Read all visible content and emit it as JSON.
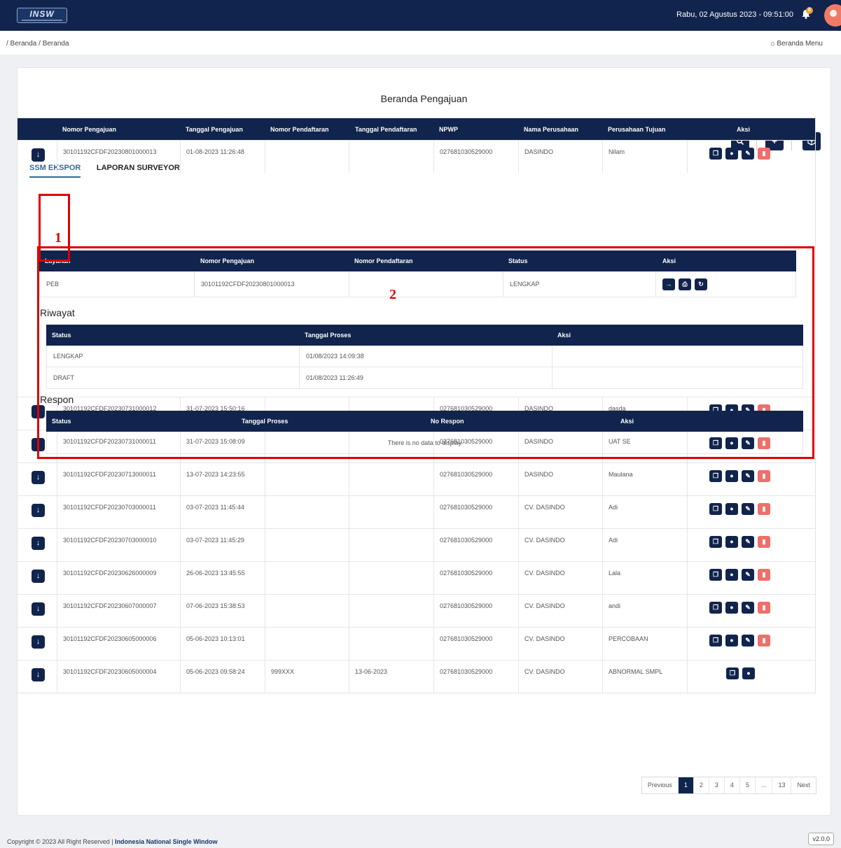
{
  "header": {
    "logo_text": "INSW",
    "datetime": "Rabu, 02 Agustus 2023 - 09:51:00",
    "notif_count": "0"
  },
  "breadcrumb": {
    "path": "/ Beranda / Beranda",
    "home_menu": "Beranda Menu"
  },
  "page": {
    "title": "Beranda Pengajuan"
  },
  "tabs": [
    "SSM EKSPOR",
    "LAPORAN SURVEYOR"
  ],
  "main_table": {
    "headers": [
      "Nomor Pengajuan",
      "Tanggal Pengajuan",
      "Nomor Pendaftaran",
      "Tanggal Pendaftaran",
      "NPWP",
      "Nama Perusahaan",
      "Perusahaan Tujuan",
      "Aksi"
    ],
    "rows": [
      {
        "no": "30101192CFDF20230801000013",
        "tgl": "01-08-2023 11:26:48",
        "nodaftar": "",
        "tgldaftar": "",
        "npwp": "027681030529000",
        "nama": "DASINDO",
        "tujuan": "Nilam"
      },
      {
        "no": "30101192CFDF20230731000012",
        "tgl": "31-07-2023 15:50:16",
        "nodaftar": "",
        "tgldaftar": "",
        "npwp": "027681030529000",
        "nama": "DASINDO",
        "tujuan": "dasda"
      },
      {
        "no": "30101192CFDF20230731000011",
        "tgl": "31-07-2023 15:08:09",
        "nodaftar": "",
        "tgldaftar": "",
        "npwp": "027681030529000",
        "nama": "DASINDO",
        "tujuan": "UAT SE"
      },
      {
        "no": "30101192CFDF20230713000011",
        "tgl": "13-07-2023 14:23:55",
        "nodaftar": "",
        "tgldaftar": "",
        "npwp": "027681030529000",
        "nama": "DASINDO",
        "tujuan": "Maulana"
      },
      {
        "no": "30101192CFDF20230703000011",
        "tgl": "03-07-2023 11:45:44",
        "nodaftar": "",
        "tgldaftar": "",
        "npwp": "027681030529000",
        "nama": "CV. DASINDO",
        "tujuan": "Adi"
      },
      {
        "no": "30101192CFDF20230703000010",
        "tgl": "03-07-2023 11:45:29",
        "nodaftar": "",
        "tgldaftar": "",
        "npwp": "027681030529000",
        "nama": "CV. DASINDO",
        "tujuan": "Adi"
      },
      {
        "no": "30101192CFDF20230626000009",
        "tgl": "26-06-2023 13:45:55",
        "nodaftar": "",
        "tgldaftar": "",
        "npwp": "027681030529000",
        "nama": "CV. DASINDO",
        "tujuan": "Lala"
      },
      {
        "no": "30101192CFDF20230607000007",
        "tgl": "07-06-2023 15:38:53",
        "nodaftar": "",
        "tgldaftar": "",
        "npwp": "027681030529000",
        "nama": "CV. DASINDO",
        "tujuan": "andi"
      },
      {
        "no": "30101192CFDF20230605000006",
        "tgl": "05-06-2023 10:13:01",
        "nodaftar": "",
        "tgldaftar": "",
        "npwp": "027681030529000",
        "nama": "CV. DASINDO",
        "tujuan": "PERCOBAAN"
      },
      {
        "no": "30101192CFDF20230605000004",
        "tgl": "05-06-2023 09:58:24",
        "nodaftar": "999XXX",
        "tgldaftar": "13-06-2023",
        "npwp": "027681030529000",
        "nama": "CV. DASINDO",
        "tujuan": "ABNORMAL SMPL"
      }
    ]
  },
  "detail": {
    "layanan_headers": [
      "Layanan",
      "Nomor Pengajuan",
      "Nomor Pendaftaran",
      "Status",
      "Aksi"
    ],
    "layanan_row": {
      "layanan": "PEB",
      "no": "30101192CFDF20230801000013",
      "nodaftar": "",
      "status": "LENGKAP"
    },
    "riwayat_title": "Riwayat",
    "riwayat_headers": [
      "Status",
      "Tanggal Proses",
      "Aksi"
    ],
    "riwayat_rows": [
      {
        "status": "LENGKAP",
        "tgl": "01/08/2023 14:09:38"
      },
      {
        "status": "DRAFT",
        "tgl": "01/08/2023 11:26:49"
      }
    ],
    "respon_title": "Respon",
    "respon_headers": [
      "Status",
      "Tanggal Proses",
      "No Respon",
      "Aksi"
    ],
    "respon_empty": "There is no data to display"
  },
  "annotations": {
    "mark1": "1",
    "mark2": "2",
    "color": "#e00000"
  },
  "pagination": [
    "Previous",
    "1",
    "2",
    "3",
    "4",
    "5",
    "...",
    "13",
    "Next"
  ],
  "footer": {
    "copyright": "Copyright © 2023 All Right Reserved |",
    "brand": "Indonesia National Single Window",
    "version": "v2.0.0"
  },
  "icons": {
    "expand": "arrow-down-icon",
    "search": "search-icon",
    "add": "plus-icon",
    "box": "box-icon",
    "copy": "copy-icon",
    "view": "eye-icon",
    "edit": "edit-icon",
    "delete": "trash-icon",
    "send": "arrow-right-icon",
    "print": "print-icon",
    "refresh": "refresh-icon",
    "home": "home-icon"
  }
}
